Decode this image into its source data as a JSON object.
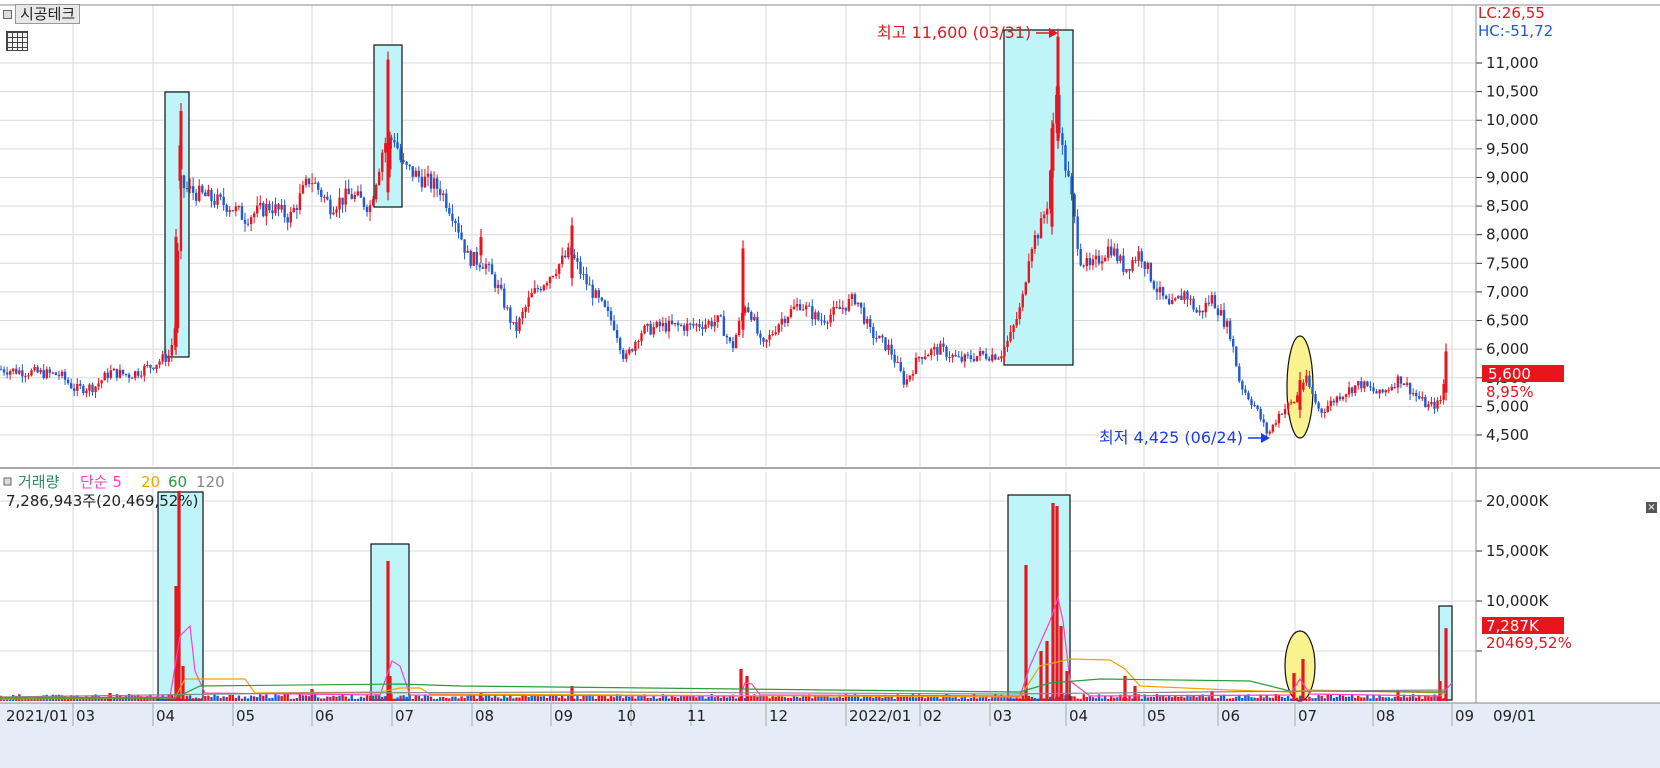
{
  "app": {
    "stock_name": "시공테크",
    "grid_icon": "table-icon"
  },
  "price_panel": {
    "lc_label": "LC:26,55",
    "hc_label": "HC:-51,72",
    "current_price": "5,600",
    "current_change": "8,95%",
    "high_annotation": "최고 11,600 (03/31)",
    "low_annotation": "최저 4,425 (06/24)",
    "y_ticks": [
      "11,000",
      "10,500",
      "10,000",
      "9,500",
      "9,000",
      "8,500",
      "8,000",
      "7,500",
      "7,000",
      "6,500",
      "6,000",
      "5,500",
      "5,000",
      "4,500"
    ]
  },
  "volume_panel": {
    "legend_title": "거래량",
    "legend_ma_label": "단순 5",
    "legend_ma_20": "20",
    "legend_ma_60": "60",
    "legend_ma_120": "120",
    "volume_readout": "7,286,943주(20,469,52%)",
    "current_volume": "7,287K",
    "current_volume_pct": "20469,52%",
    "y_ticks": [
      "20,000K",
      "15,000K",
      "10,000K"
    ],
    "close_icon": "close-icon"
  },
  "x_axis": {
    "labels": [
      "2021/01",
      "03",
      "04",
      "05",
      "06",
      "07",
      "08",
      "09",
      "10",
      "11",
      "12",
      "2022/01",
      "02",
      "03",
      "04",
      "05",
      "06",
      "07",
      "08",
      "09",
      "09/01"
    ]
  },
  "colors": {
    "up": "#e8141e",
    "down": "#1e5ad2",
    "highlight_box": "#bff5f9",
    "ellipse": "#f9f28e",
    "grid": "#d9d9d9",
    "ma5": "#ff40c0",
    "ma20": "#f5a200",
    "ma60": "#2a9d3a",
    "ma120": "#888888"
  },
  "chart_data": [
    {
      "type": "line",
      "title": "시공테크",
      "ylim": [
        4200,
        11800
      ],
      "x": [
        "2021/01",
        "2021/02",
        "2021/03",
        "2021/04a",
        "2021/04b",
        "2021/05",
        "2021/06",
        "2021/07",
        "2021/08",
        "2021/09",
        "2021/10",
        "2021/11",
        "2021/12",
        "2022/01",
        "2022/02",
        "2022/03",
        "2022/03b",
        "2022/04",
        "2022/05",
        "2022/06",
        "2022/06b",
        "2022/07",
        "2022/08",
        "2022/09"
      ],
      "series": [
        {
          "values": [
            5600,
            5300,
            5500,
            5900,
            8800,
            8400,
            8700,
            9000,
            7500,
            7000,
            6100,
            6400,
            6600,
            5700,
            5800,
            6000,
            9500,
            8000,
            7400,
            6400,
            4500,
            5200,
            5400,
            5600
          ]
        }
      ]
    },
    {
      "type": "bar",
      "title": "거래량",
      "ylim": [
        0,
        22000
      ],
      "x": [
        "2021/04",
        "2021/07",
        "2021/11",
        "2022/03",
        "2022/03b",
        "2022/07",
        "2022/09"
      ],
      "series": [
        {
          "values": [
            20000,
            14000,
            3000,
            13600,
            19800,
            4200,
            7287
          ]
        }
      ]
    }
  ]
}
